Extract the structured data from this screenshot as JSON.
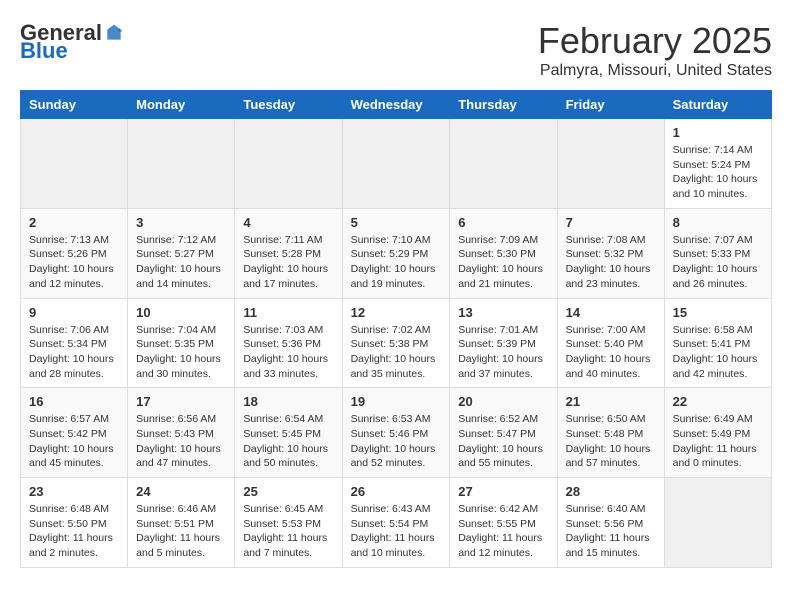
{
  "header": {
    "logo_general": "General",
    "logo_blue": "Blue",
    "month_title": "February 2025",
    "location": "Palmyra, Missouri, United States"
  },
  "weekdays": [
    "Sunday",
    "Monday",
    "Tuesday",
    "Wednesday",
    "Thursday",
    "Friday",
    "Saturday"
  ],
  "weeks": [
    {
      "days": [
        {
          "num": "",
          "info": ""
        },
        {
          "num": "",
          "info": ""
        },
        {
          "num": "",
          "info": ""
        },
        {
          "num": "",
          "info": ""
        },
        {
          "num": "",
          "info": ""
        },
        {
          "num": "",
          "info": ""
        },
        {
          "num": "1",
          "info": "Sunrise: 7:14 AM\nSunset: 5:24 PM\nDaylight: 10 hours\nand 10 minutes."
        }
      ]
    },
    {
      "days": [
        {
          "num": "2",
          "info": "Sunrise: 7:13 AM\nSunset: 5:26 PM\nDaylight: 10 hours\nand 12 minutes."
        },
        {
          "num": "3",
          "info": "Sunrise: 7:12 AM\nSunset: 5:27 PM\nDaylight: 10 hours\nand 14 minutes."
        },
        {
          "num": "4",
          "info": "Sunrise: 7:11 AM\nSunset: 5:28 PM\nDaylight: 10 hours\nand 17 minutes."
        },
        {
          "num": "5",
          "info": "Sunrise: 7:10 AM\nSunset: 5:29 PM\nDaylight: 10 hours\nand 19 minutes."
        },
        {
          "num": "6",
          "info": "Sunrise: 7:09 AM\nSunset: 5:30 PM\nDaylight: 10 hours\nand 21 minutes."
        },
        {
          "num": "7",
          "info": "Sunrise: 7:08 AM\nSunset: 5:32 PM\nDaylight: 10 hours\nand 23 minutes."
        },
        {
          "num": "8",
          "info": "Sunrise: 7:07 AM\nSunset: 5:33 PM\nDaylight: 10 hours\nand 26 minutes."
        }
      ]
    },
    {
      "days": [
        {
          "num": "9",
          "info": "Sunrise: 7:06 AM\nSunset: 5:34 PM\nDaylight: 10 hours\nand 28 minutes."
        },
        {
          "num": "10",
          "info": "Sunrise: 7:04 AM\nSunset: 5:35 PM\nDaylight: 10 hours\nand 30 minutes."
        },
        {
          "num": "11",
          "info": "Sunrise: 7:03 AM\nSunset: 5:36 PM\nDaylight: 10 hours\nand 33 minutes."
        },
        {
          "num": "12",
          "info": "Sunrise: 7:02 AM\nSunset: 5:38 PM\nDaylight: 10 hours\nand 35 minutes."
        },
        {
          "num": "13",
          "info": "Sunrise: 7:01 AM\nSunset: 5:39 PM\nDaylight: 10 hours\nand 37 minutes."
        },
        {
          "num": "14",
          "info": "Sunrise: 7:00 AM\nSunset: 5:40 PM\nDaylight: 10 hours\nand 40 minutes."
        },
        {
          "num": "15",
          "info": "Sunrise: 6:58 AM\nSunset: 5:41 PM\nDaylight: 10 hours\nand 42 minutes."
        }
      ]
    },
    {
      "days": [
        {
          "num": "16",
          "info": "Sunrise: 6:57 AM\nSunset: 5:42 PM\nDaylight: 10 hours\nand 45 minutes."
        },
        {
          "num": "17",
          "info": "Sunrise: 6:56 AM\nSunset: 5:43 PM\nDaylight: 10 hours\nand 47 minutes."
        },
        {
          "num": "18",
          "info": "Sunrise: 6:54 AM\nSunset: 5:45 PM\nDaylight: 10 hours\nand 50 minutes."
        },
        {
          "num": "19",
          "info": "Sunrise: 6:53 AM\nSunset: 5:46 PM\nDaylight: 10 hours\nand 52 minutes."
        },
        {
          "num": "20",
          "info": "Sunrise: 6:52 AM\nSunset: 5:47 PM\nDaylight: 10 hours\nand 55 minutes."
        },
        {
          "num": "21",
          "info": "Sunrise: 6:50 AM\nSunset: 5:48 PM\nDaylight: 10 hours\nand 57 minutes."
        },
        {
          "num": "22",
          "info": "Sunrise: 6:49 AM\nSunset: 5:49 PM\nDaylight: 11 hours\nand 0 minutes."
        }
      ]
    },
    {
      "days": [
        {
          "num": "23",
          "info": "Sunrise: 6:48 AM\nSunset: 5:50 PM\nDaylight: 11 hours\nand 2 minutes."
        },
        {
          "num": "24",
          "info": "Sunrise: 6:46 AM\nSunset: 5:51 PM\nDaylight: 11 hours\nand 5 minutes."
        },
        {
          "num": "25",
          "info": "Sunrise: 6:45 AM\nSunset: 5:53 PM\nDaylight: 11 hours\nand 7 minutes."
        },
        {
          "num": "26",
          "info": "Sunrise: 6:43 AM\nSunset: 5:54 PM\nDaylight: 11 hours\nand 10 minutes."
        },
        {
          "num": "27",
          "info": "Sunrise: 6:42 AM\nSunset: 5:55 PM\nDaylight: 11 hours\nand 12 minutes."
        },
        {
          "num": "28",
          "info": "Sunrise: 6:40 AM\nSunset: 5:56 PM\nDaylight: 11 hours\nand 15 minutes."
        },
        {
          "num": "",
          "info": ""
        }
      ]
    }
  ]
}
